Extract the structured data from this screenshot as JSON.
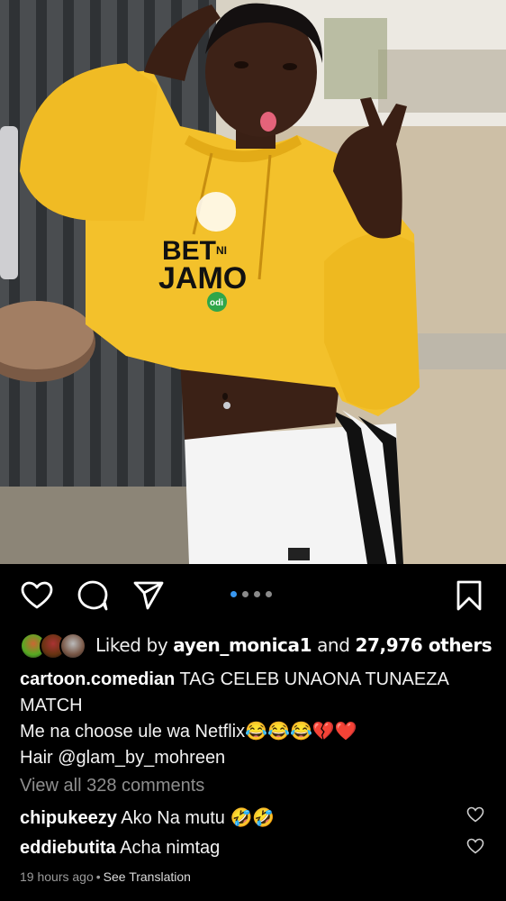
{
  "post": {
    "carousel": {
      "total": 4,
      "active": 0
    },
    "likes": {
      "prefix": "Liked by",
      "user": "ayen_monica1",
      "and": "and",
      "count": "27,976 others"
    },
    "caption": {
      "username": "cartoon.comedian",
      "line1": "TAG CELEB UNAONA TUNAEZA MATCH",
      "line2": "Me na choose ule wa Netflix",
      "line2_emoji": "😂😂😂💔❤️",
      "line3": "Hair @glam_by_mohreen"
    },
    "view_all_comments": "View all 328 comments",
    "comments": [
      {
        "username": "chipukeezy",
        "text": "Ako Na mutu",
        "emoji": "🤣🤣"
      },
      {
        "username": "eddiebutita",
        "text": "Acha nimtag",
        "emoji": ""
      }
    ],
    "time": "19 hours ago",
    "separator": "•",
    "translate": "See Translation",
    "hoodie_text": {
      "line1": "BET",
      "ni": "NI",
      "line2": "JAMO",
      "brand": "odi"
    }
  },
  "colors": {
    "accent": "#3897f0",
    "hoodie": "#f3c12b",
    "heart": "#e0245e"
  },
  "icons": [
    "heart-icon",
    "comment-icon",
    "share-icon",
    "bookmark-icon"
  ]
}
